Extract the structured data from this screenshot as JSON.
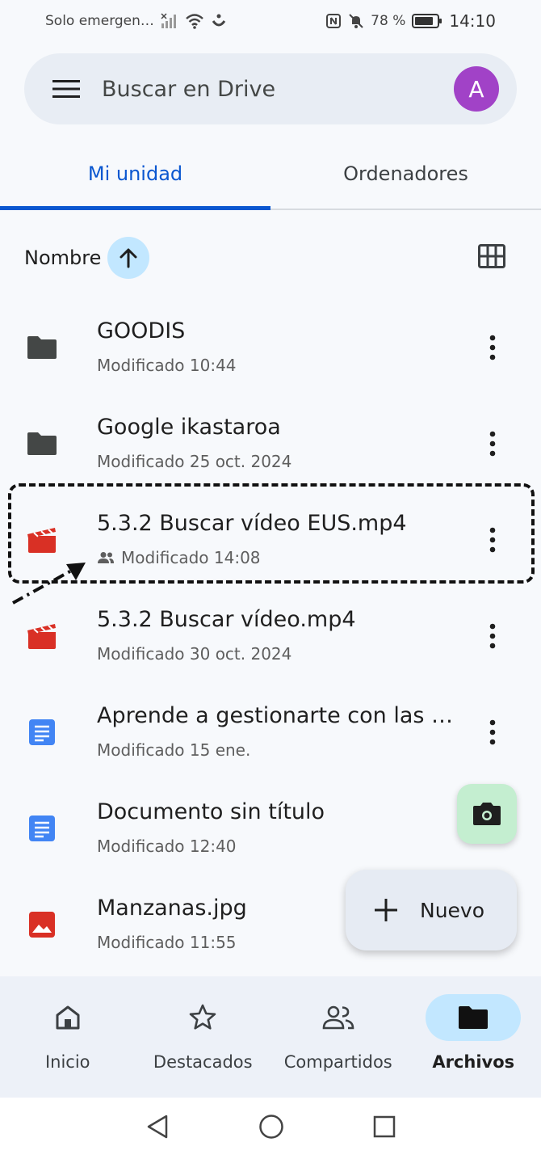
{
  "status_bar": {
    "carrier": "Solo emergen…",
    "battery": "78 %",
    "time": "14:10"
  },
  "search": {
    "placeholder": "Buscar en Drive",
    "avatar_letter": "A"
  },
  "tabs": [
    {
      "label": "Mi unidad",
      "active": true
    },
    {
      "label": "Ordenadores",
      "active": false
    }
  ],
  "sort": {
    "label": "Nombre"
  },
  "files": [
    {
      "name": "GOODIS",
      "meta": "Modificado 10:44",
      "icon": "folder-icon"
    },
    {
      "name": "Google ikastaroa",
      "meta": "Modificado 25 oct. 2024",
      "icon": "folder-icon"
    },
    {
      "name": "5.3.2 Buscar vídeo EUS.mp4",
      "meta": "Modificado 14:08",
      "icon": "video-icon",
      "shared": true
    },
    {
      "name": "5.3.2 Buscar vídeo.mp4",
      "meta": "Modificado 30 oct. 2024",
      "icon": "video-icon"
    },
    {
      "name": "Aprende a gestionarte con las …",
      "meta": "Modificado 15 ene.",
      "icon": "doc-icon"
    },
    {
      "name": "Documento sin título",
      "meta": "Modificado 12:40",
      "icon": "doc-icon"
    },
    {
      "name": "Manzanas.jpg",
      "meta": "Modificado 11:55",
      "icon": "image-icon"
    }
  ],
  "fab": {
    "new_label": "Nuevo"
  },
  "bottom_nav": [
    {
      "label": "Inicio",
      "icon": "home-icon"
    },
    {
      "label": "Destacados",
      "icon": "star-icon"
    },
    {
      "label": "Compartidos",
      "icon": "people-icon"
    },
    {
      "label": "Archivos",
      "icon": "folder-icon",
      "active": true
    }
  ],
  "colors": {
    "accent": "#0b57d0",
    "video": "#d93025",
    "doc": "#4285f4",
    "image": "#d93025",
    "folder": "#444746",
    "avatar": "#a142c7"
  }
}
